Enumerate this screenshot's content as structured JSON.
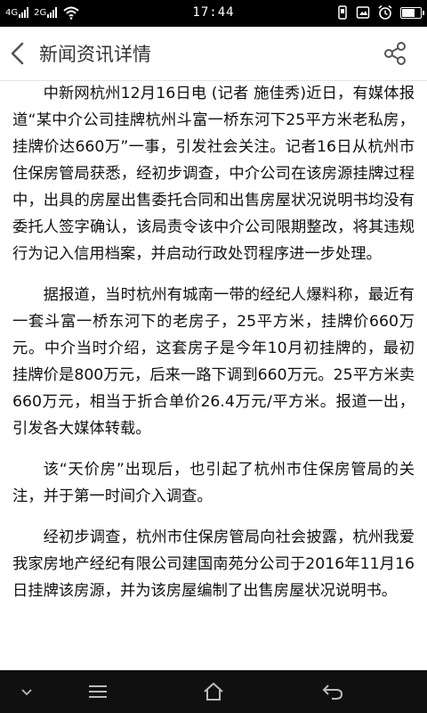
{
  "status_bar": {
    "time": "17:44",
    "net1": "4G",
    "net2": "2G",
    "icons": [
      "signal-4g-icon",
      "signal-2g-icon",
      "wifi-icon",
      "usb-debug-icon",
      "screenshot-icon",
      "alarm-icon",
      "battery-icon"
    ]
  },
  "header": {
    "title": "新闻资讯详情",
    "back_icon": "back-arrow-icon",
    "share_icon": "share-icon"
  },
  "article": {
    "paragraphs": [
      "中新网杭州12月16日电 (记者 施佳秀)近日，有媒体报道“某中介公司挂牌杭州斗富一桥东河下25平方米老私房，挂牌价达660万”一事，引发社会关注。记者16日从杭州市住保房管局获悉，经初步调查，中介公司在该房源挂牌过程中，出具的房屋出售委托合同和出售房屋状况说明书均没有委托人签字确认，该局责令该中介公司限期整改，将其违规行为记入信用档案，并启动行政处罚程序进一步处理。",
      "据报道，当时杭州有城南一带的经纪人爆料称，最近有一套斗富一桥东河下的老房子，25平方米，挂牌价660万元。中介当时介绍，这套房子是今年10月初挂牌的，最初挂牌价是800万元，后来一路下调到660万元。25平方米卖660万元，相当于折合单价26.4万元/平方米。报道一出，引发各大媒体转载。",
      "该“天价房”出现后，也引起了杭州市住保房管局的关注，并于第一时间介入调查。",
      "经初步调查，杭州市住保房管局向社会披露，杭州我爱我家房地产经纪有限公司建国南苑分公司于2016年11月16日挂牌该房源，并为该房屋编制了出售房屋状况说明书。"
    ]
  },
  "nav_bar": {
    "icons": [
      "chevron-down-icon",
      "menu-icon",
      "home-icon",
      "back-icon"
    ]
  }
}
